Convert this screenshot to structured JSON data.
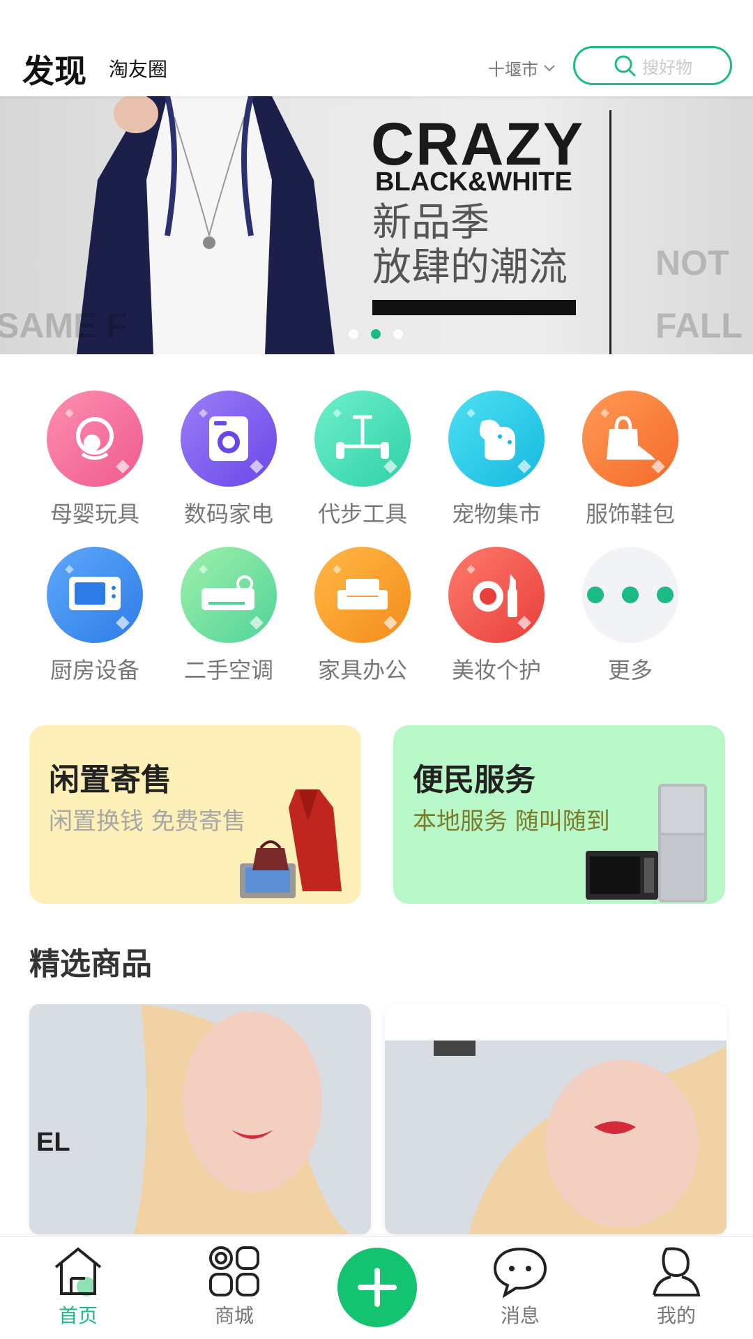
{
  "header": {
    "title": "发现",
    "subtitle": "淘友圈",
    "city": "十堰市",
    "search_placeholder": "搜好物"
  },
  "banner": {
    "headline": "CRAZY",
    "subheadline": "BLACK&WHITE",
    "line1": "新品季",
    "line2": "放肆的潮流",
    "ghost_left": "SAME F",
    "ghost_right": "FALL",
    "ghost_right_top": "NOT",
    "slide_count": 3,
    "active_slide": 2
  },
  "categories": [
    {
      "label": "母婴玩具",
      "icon": "baby-icon",
      "color": "#f36e9e"
    },
    {
      "label": "数码家电",
      "icon": "washing-machine-icon",
      "color": "#7b5cf0"
    },
    {
      "label": "代步工具",
      "icon": "scooter-icon",
      "color": "#3ed8b2"
    },
    {
      "label": "宠物集市",
      "icon": "dog-icon",
      "color": "#27c9e6"
    },
    {
      "label": "服饰鞋包",
      "icon": "shopping-bag-icon",
      "color": "#fb7a3a"
    },
    {
      "label": "厨房设备",
      "icon": "microwave-icon",
      "color": "#3b8ff0"
    },
    {
      "label": "二手空调",
      "icon": "air-conditioner-icon",
      "color": "#6fe2a2"
    },
    {
      "label": "家具办公",
      "icon": "sofa-icon",
      "color": "#fb9b2a"
    },
    {
      "label": "美妆个护",
      "icon": "cosmetics-icon",
      "color": "#f2524a"
    },
    {
      "label": "更多",
      "icon": "more-icon",
      "color": "#f1f3f6"
    }
  ],
  "features": {
    "left": {
      "title": "闲置寄售",
      "subtitle": "闲置换钱 免费寄售"
    },
    "right": {
      "title": "便民服务",
      "subtitle": "本地服务 随叫随到"
    }
  },
  "section": {
    "title": "精选商品"
  },
  "tabbar": {
    "items": [
      {
        "label": "首页",
        "icon": "home-icon"
      },
      {
        "label": "商城",
        "icon": "grid-icon"
      },
      {
        "label": "",
        "icon": "plus-icon"
      },
      {
        "label": "消息",
        "icon": "message-icon"
      },
      {
        "label": "我的",
        "icon": "user-icon"
      }
    ]
  },
  "colors": {
    "accent": "#1cba84",
    "plus": "#14c36f"
  }
}
